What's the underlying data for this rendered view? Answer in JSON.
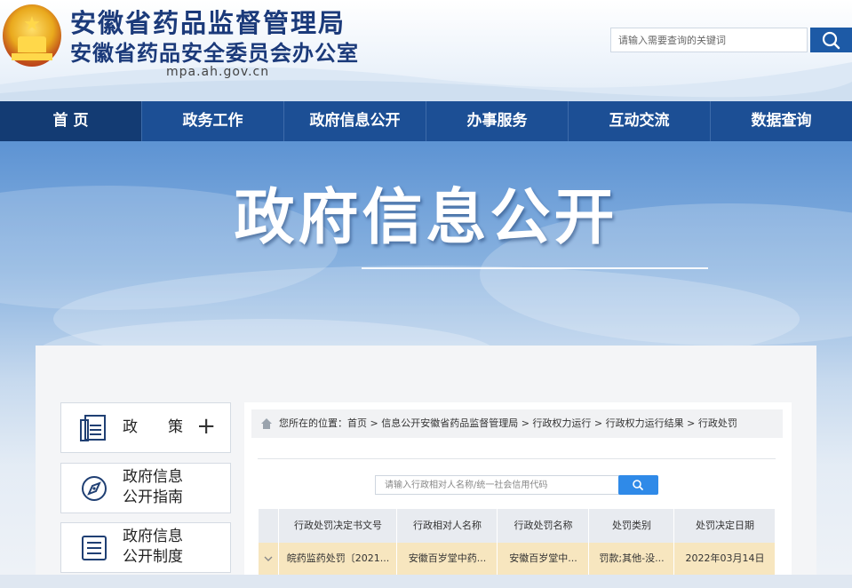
{
  "header": {
    "title_line1": "安徽省药品监督管理局",
    "title_line2": "安徽省药品安全委员会办公室",
    "domain": "mpa.ah.gov.cn",
    "search": {
      "placeholder": "请输入需要查询的关键词",
      "icon": "search-icon"
    }
  },
  "nav": {
    "items": [
      {
        "label": "首 页",
        "active": true
      },
      {
        "label": "政务工作"
      },
      {
        "label": "政府信息公开"
      },
      {
        "label": "办事服务"
      },
      {
        "label": "互动交流"
      },
      {
        "label": "数据查询"
      }
    ]
  },
  "banner": {
    "title": "政府信息公开"
  },
  "sidebar": {
    "items": [
      {
        "label": "政　　策",
        "icon": "document-icon",
        "expand": "+"
      },
      {
        "label_line1": "政府信息",
        "label_line2": "公开指南",
        "icon": "compass-icon"
      },
      {
        "label_line1": "政府信息",
        "label_line2": "公开制度",
        "icon": "list-icon"
      }
    ]
  },
  "breadcrumb": {
    "text": "您所在的位置：首页 > 信息公开安徽省药品监督管理局 > 行政权力运行 > 行政权力运行结果 > 行政处罚"
  },
  "query": {
    "placeholder": "请输入行政相对人名称/统一社会信用代码",
    "icon": "search-icon"
  },
  "table": {
    "columns": [
      "行政处罚决定书文号",
      "行政相对人名称",
      "行政处罚名称",
      "处罚类别",
      "处罚决定日期"
    ],
    "rows": [
      {
        "doc_no": "皖药监药处罚〔2021...",
        "party": "安徽百岁堂中药...",
        "name": "安徽百岁堂中...",
        "category": "罚款;其他-没...",
        "date": "2022年03月14日"
      }
    ]
  },
  "colors": {
    "nav_bg": "#1c4f95",
    "nav_active": "#133b73",
    "brand_text": "#1b3a7a",
    "search_button": "#1d5aa6",
    "query_button": "#2f8ae8",
    "row_highlight": "#f7e6bf"
  }
}
